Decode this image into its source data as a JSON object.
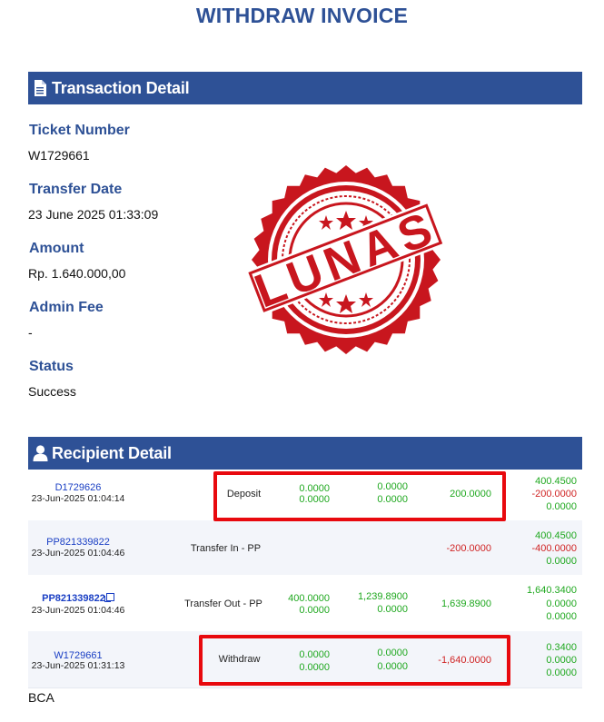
{
  "title": "WITHDRAW INVOICE",
  "transaction": {
    "header": "Transaction Detail",
    "header_icon": "document-icon",
    "fields": [
      {
        "label": "Ticket Number",
        "value": "W1729661"
      },
      {
        "label": "Transfer Date",
        "value": "23 June 2025 01:33:09"
      },
      {
        "label": "Amount",
        "value": "Rp. 1.640.000,00"
      },
      {
        "label": "Admin Fee",
        "value": "-"
      },
      {
        "label": "Status",
        "value": "Success"
      }
    ]
  },
  "stamp": {
    "text": "LUNAS",
    "color": "#c8161e"
  },
  "recipient": {
    "header": "Recipient Detail",
    "header_icon": "user-icon",
    "rows": [
      {
        "id": "D1729626",
        "date": "23-Jun-2025 01:04:14",
        "type": "Deposit",
        "col1": [
          "0.0000",
          "0.0000"
        ],
        "col2": [
          "0.0000",
          "0.0000"
        ],
        "col3": "200.0000",
        "balance": [
          "400.4500",
          "-200.0000",
          "0.0000"
        ]
      },
      {
        "id": "PP821339822",
        "date": "23-Jun-2025 01:04:46",
        "type": "Transfer In - PP",
        "col1": [
          "",
          ""
        ],
        "col2": [
          "",
          ""
        ],
        "col3": "-200.0000",
        "balance": [
          "400.4500",
          "-400.0000",
          "0.0000"
        ]
      },
      {
        "id": "PP821339822",
        "date": "23-Jun-2025 01:04:46",
        "type": "Transfer Out - PP",
        "col1": [
          "400.0000",
          "0.0000"
        ],
        "col2": [
          "1,239.8900",
          "0.0000"
        ],
        "col3": "1,639.8900",
        "balance": [
          "1,640.3400",
          "0.0000",
          "0.0000"
        ]
      },
      {
        "id": "W1729661",
        "date": "23-Jun-2025 01:31:13",
        "type": "Withdraw",
        "col1": [
          "0.0000",
          "0.0000"
        ],
        "col2": [
          "0.0000",
          "0.0000"
        ],
        "col3": "-1,640.0000",
        "balance": [
          "0.3400",
          "0.0000",
          "0.0000"
        ]
      }
    ],
    "bank": "BCA"
  },
  "colors": {
    "brand": "#2e5196",
    "positive": "#1fa81f",
    "negative": "#d02424",
    "highlight": "#e8090e"
  }
}
